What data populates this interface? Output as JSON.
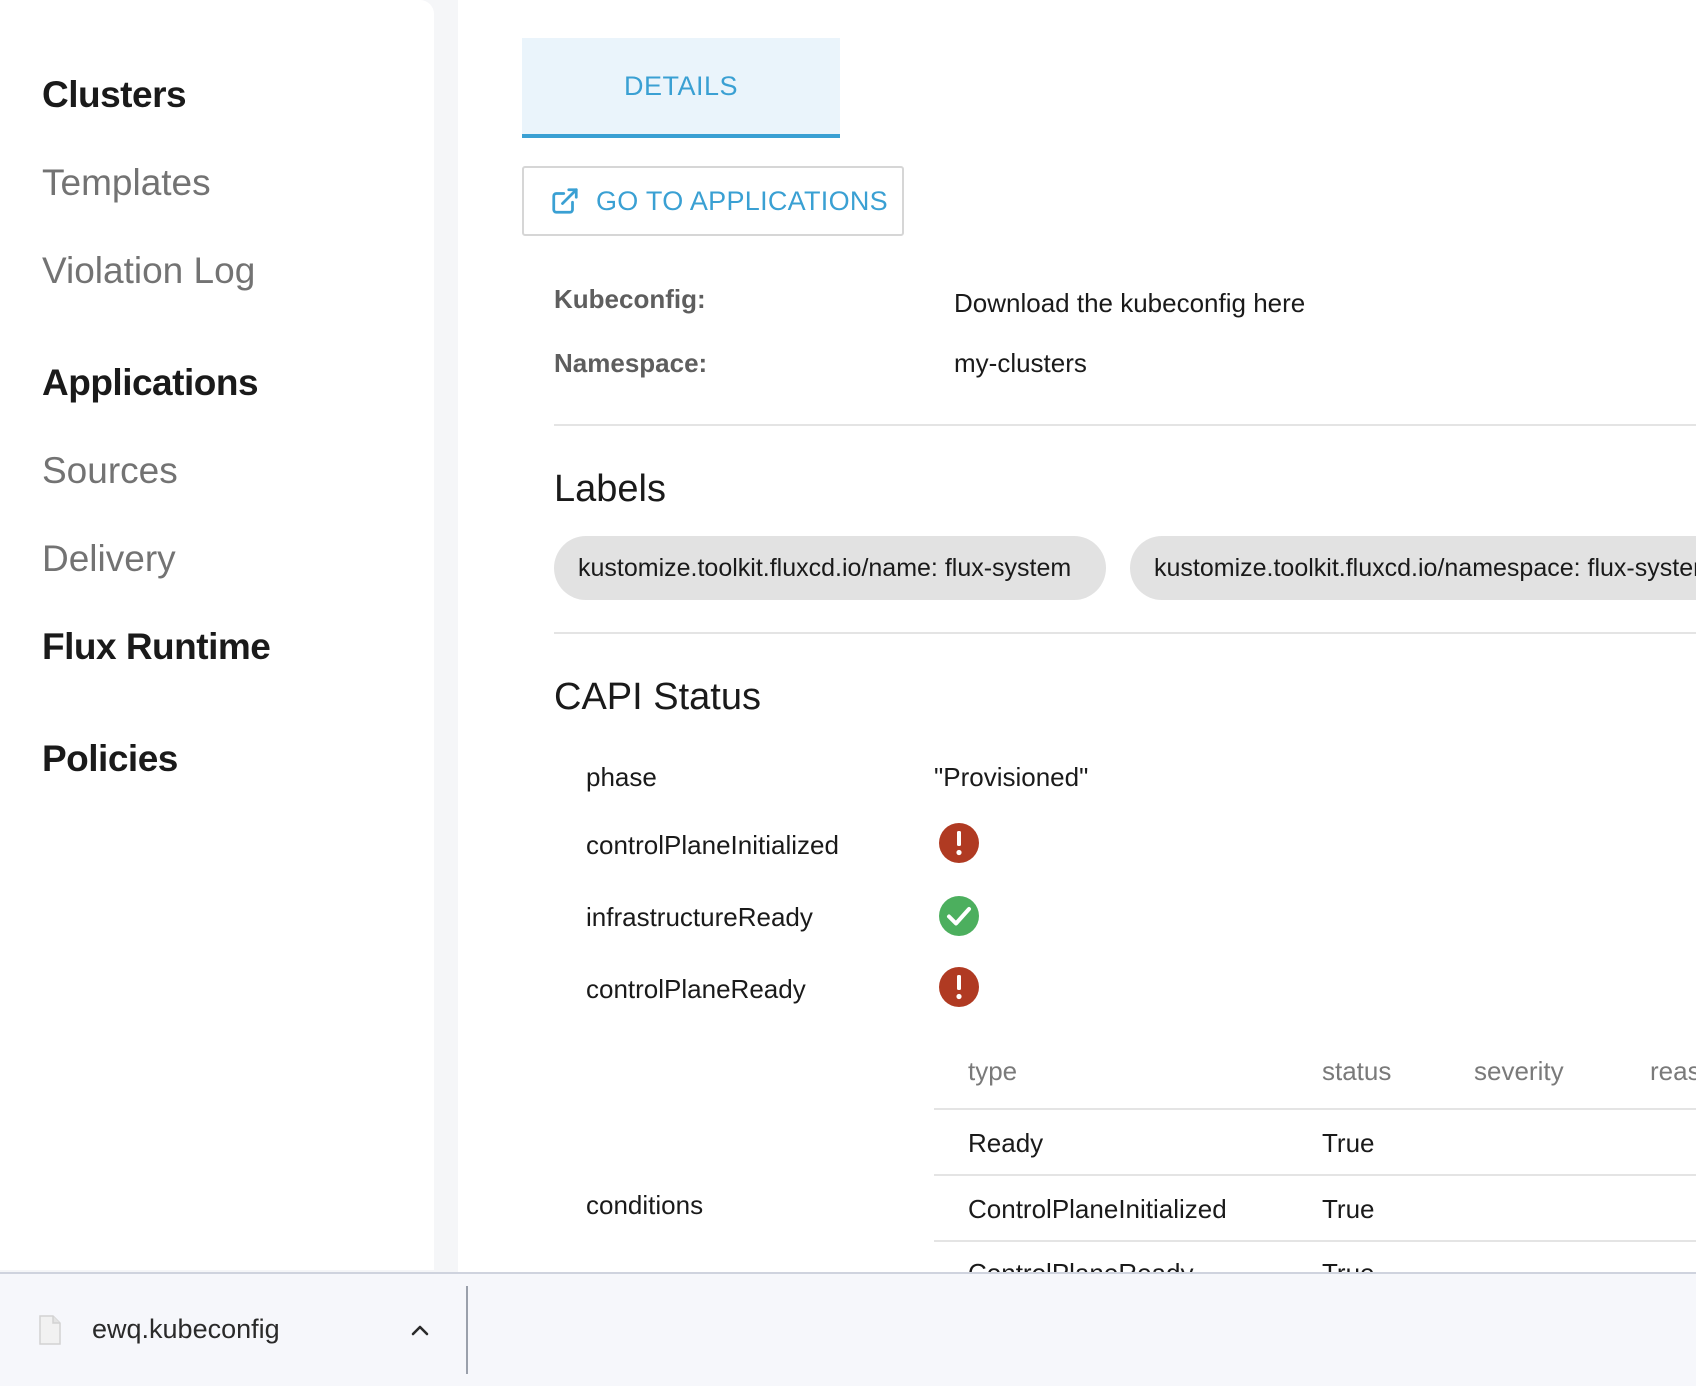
{
  "sidebar": {
    "items": [
      {
        "label": "Clusters",
        "kind": "group"
      },
      {
        "label": "Templates",
        "kind": "sub"
      },
      {
        "label": "Violation Log",
        "kind": "sub"
      },
      {
        "label": "Applications",
        "kind": "group"
      },
      {
        "label": "Sources",
        "kind": "sub"
      },
      {
        "label": "Delivery",
        "kind": "sub"
      },
      {
        "label": "Flux Runtime",
        "kind": "group"
      },
      {
        "label": "Policies",
        "kind": "group"
      }
    ]
  },
  "main": {
    "tab_label": "DETAILS",
    "go_to_applications_label": "GO TO APPLICATIONS",
    "info": {
      "kubeconfig_key": "Kubeconfig:",
      "kubeconfig_value": "Download the kubeconfig here",
      "namespace_key": "Namespace:",
      "namespace_value": "my-clusters"
    },
    "labels_title": "Labels",
    "labels": [
      "kustomize.toolkit.fluxcd.io/name: flux-system",
      "kustomize.toolkit.fluxcd.io/namespace: flux-system"
    ],
    "capi_title": "CAPI Status",
    "capi": {
      "phase_key": "phase",
      "phase_value": "\"Provisioned\"",
      "control_plane_initialized_key": "controlPlaneInitialized",
      "control_plane_initialized_icon": "error-icon",
      "infrastructure_ready_key": "infrastructureReady",
      "infrastructure_ready_icon": "check-icon",
      "control_plane_ready_key": "controlPlaneReady",
      "control_plane_ready_icon": "error-icon",
      "conditions_key": "conditions",
      "conditions_headers": [
        "type",
        "status",
        "severity",
        "reason"
      ],
      "conditions_rows": [
        {
          "type": "Ready",
          "status": "True"
        },
        {
          "type": "ControlPlaneInitialized",
          "status": "True"
        },
        {
          "type": "ControlPlaneReady",
          "status": "True"
        }
      ]
    }
  },
  "downloads": {
    "file_name": "ewq.kubeconfig",
    "file_icon": "file-icon",
    "chevron_icon": "chevron-up-icon"
  },
  "colors": {
    "accent": "#3aa0d3",
    "error": "#b03a22",
    "success": "#4caf5e"
  }
}
